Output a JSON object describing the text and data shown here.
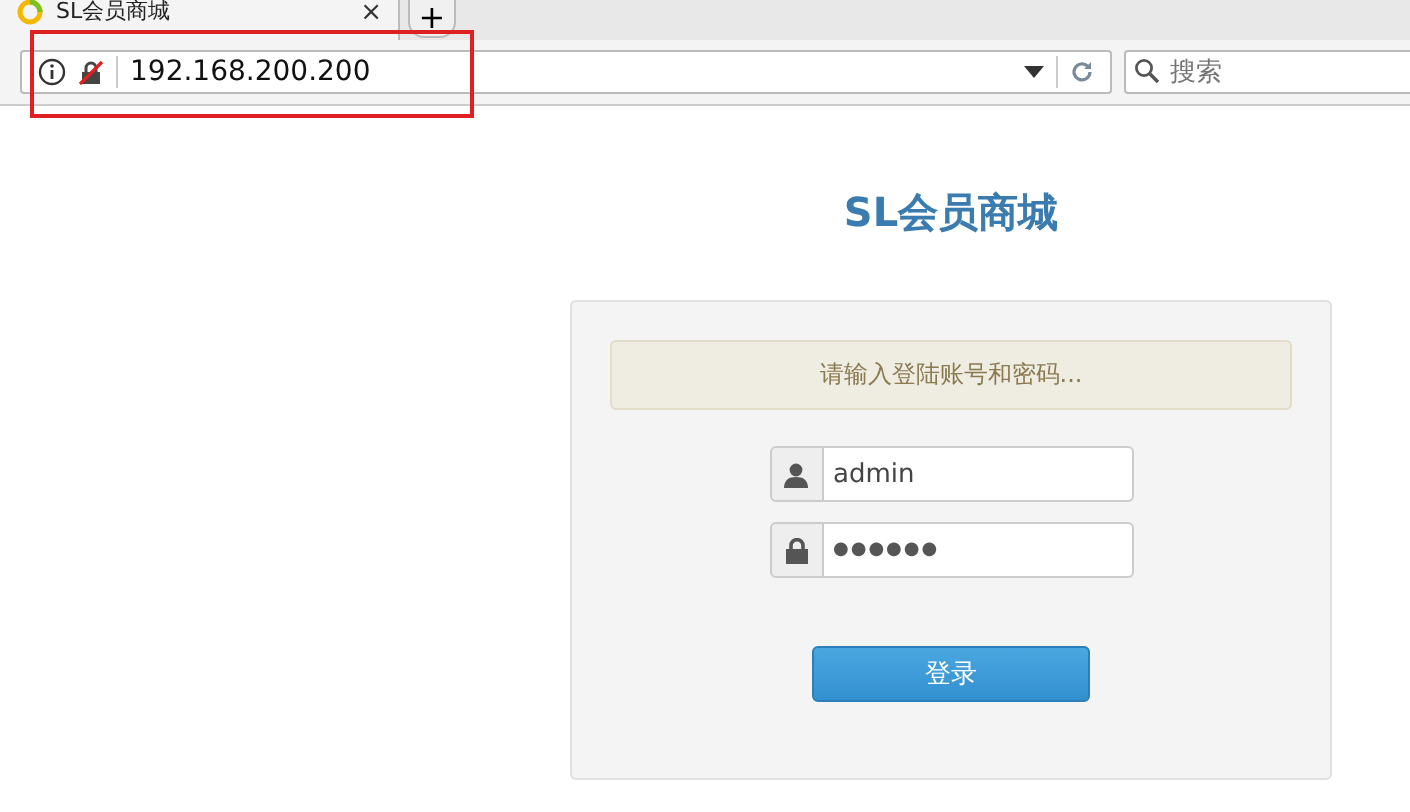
{
  "browser": {
    "tab": {
      "title": "SL会员商城",
      "close": "×"
    },
    "new_tab": "+",
    "address": "192.168.200.200",
    "search": {
      "placeholder": "搜索"
    },
    "highlight": true
  },
  "page": {
    "title": "SL会员商城",
    "notice": "请输入登陆账号和密码...",
    "fields": [
      {
        "kind": "user",
        "value": "admin"
      },
      {
        "kind": "password",
        "value": "●●●●●●"
      }
    ],
    "button": "登录"
  }
}
